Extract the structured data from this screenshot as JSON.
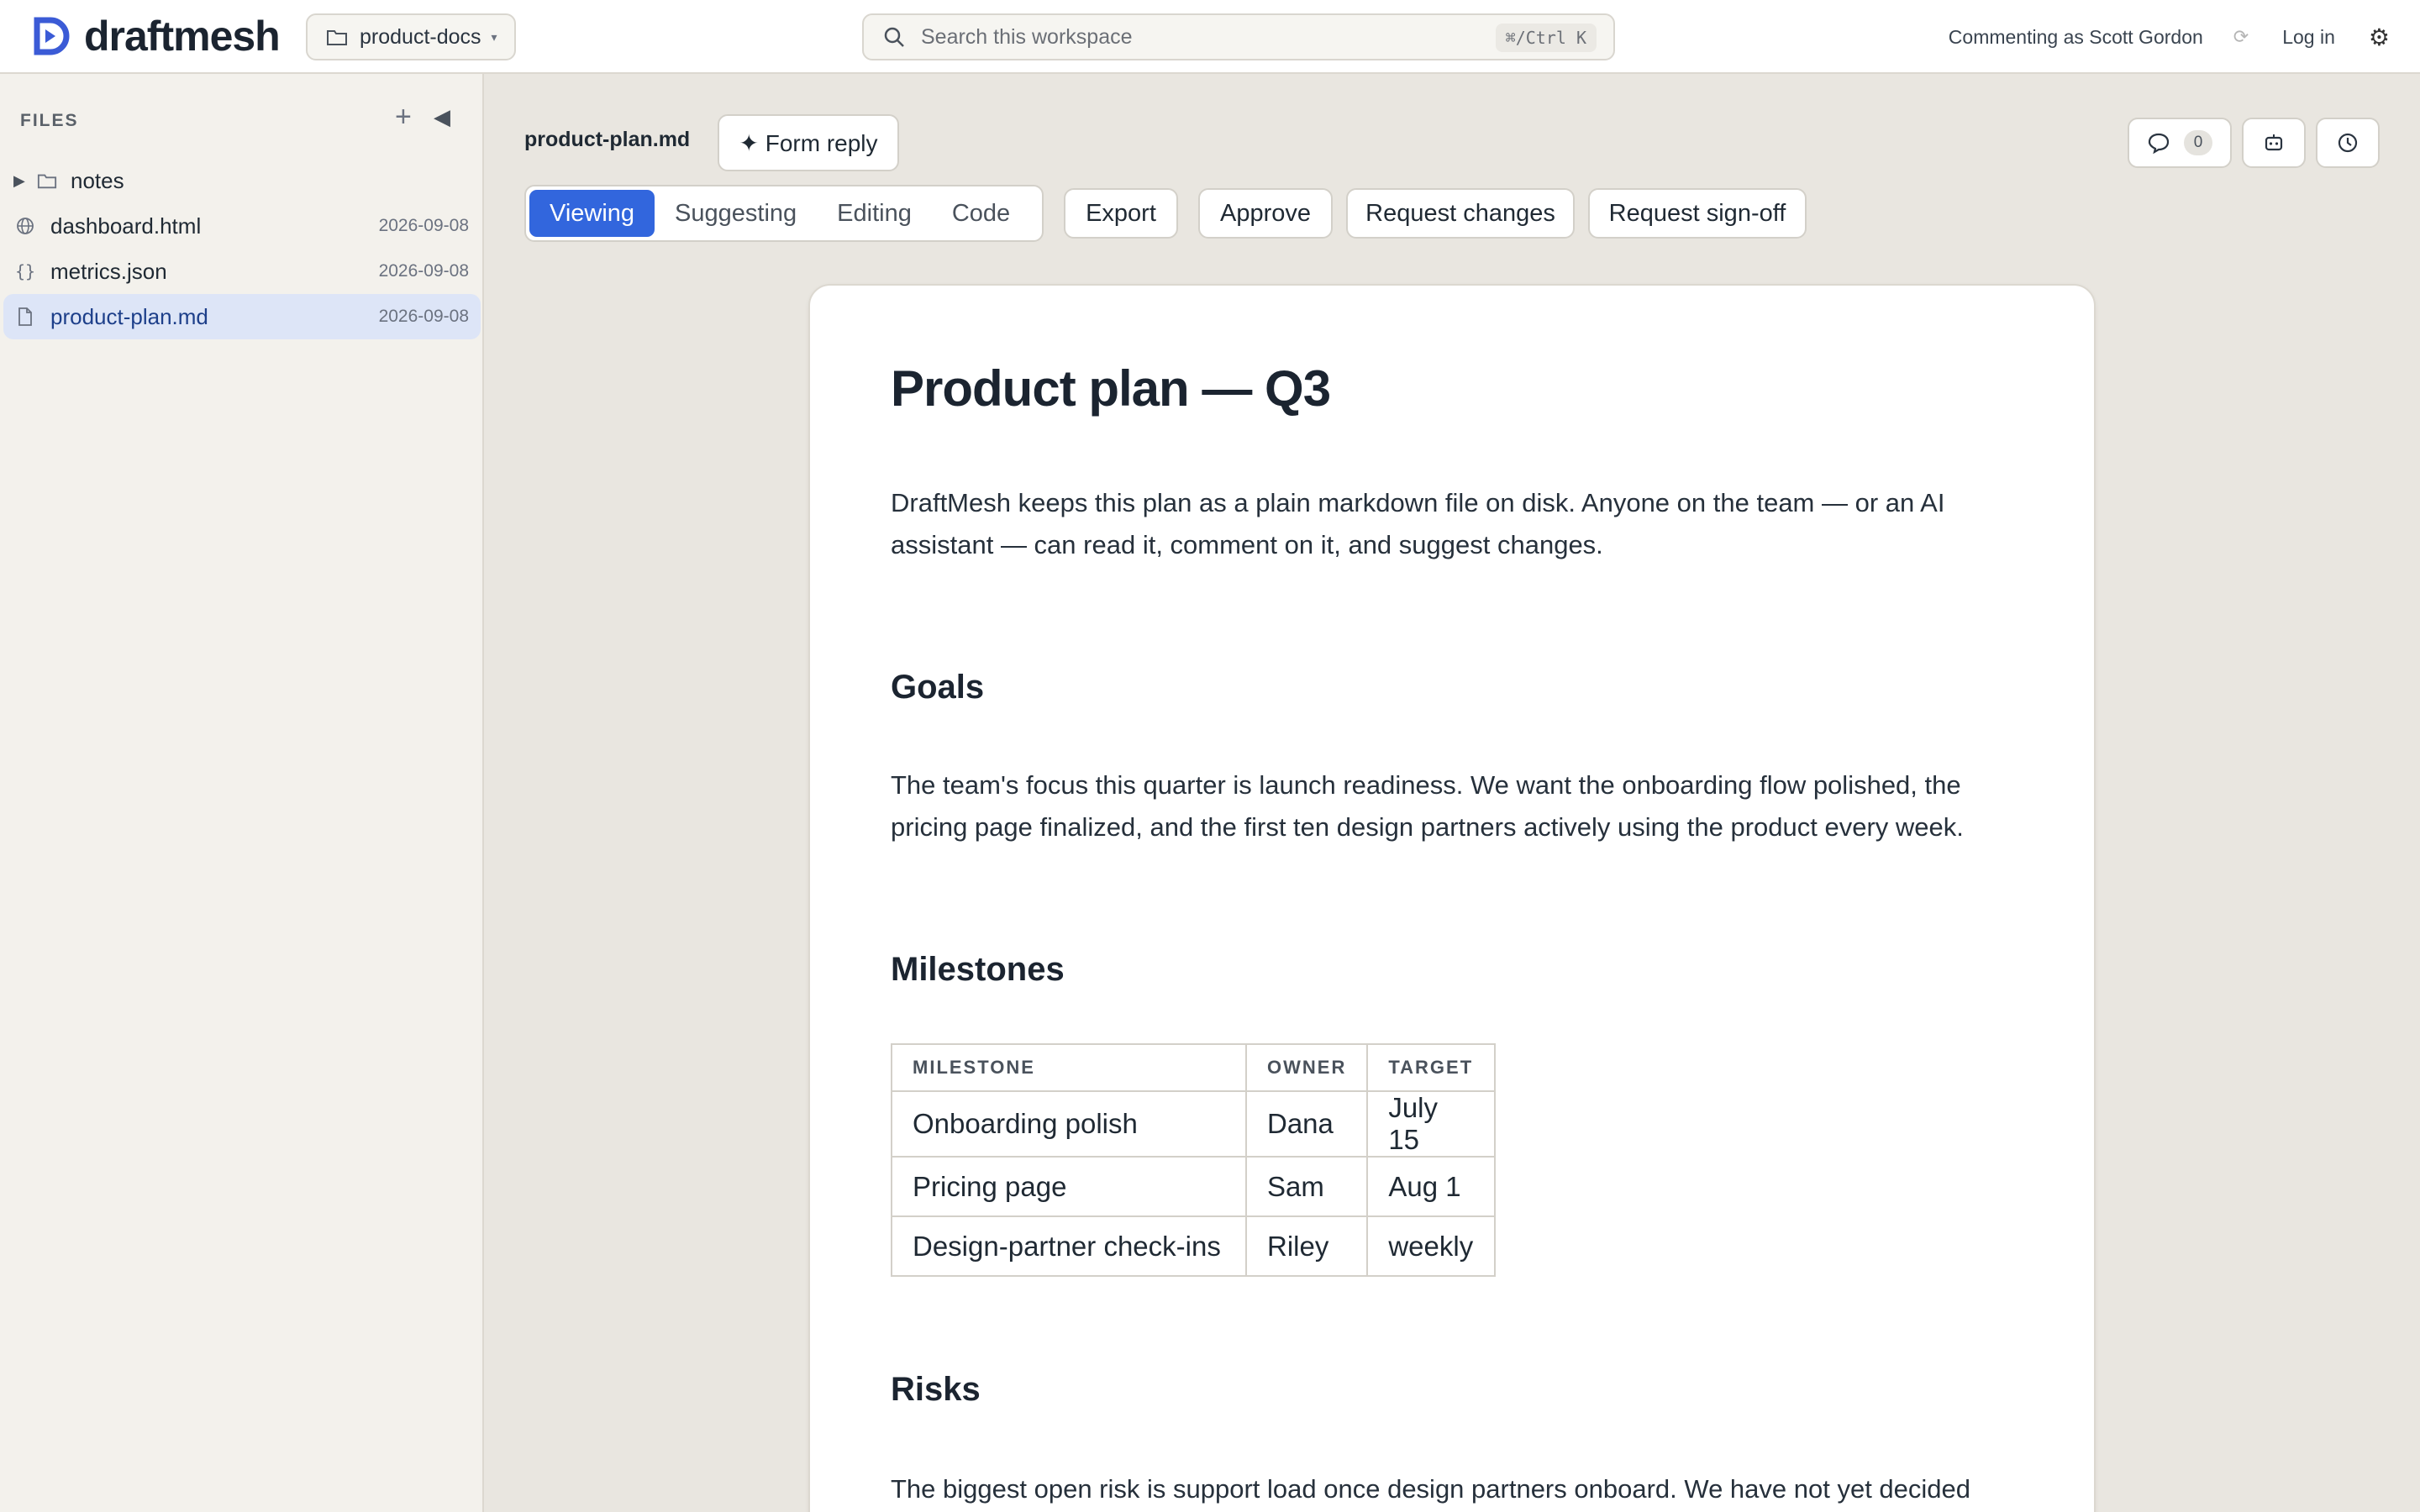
{
  "app": {
    "name": "draftmesh"
  },
  "workspace": {
    "label": "product-docs"
  },
  "search": {
    "placeholder": "Search this workspace",
    "shortcut": "⌘/Ctrl K"
  },
  "topbar": {
    "commenting_as": "Commenting as Scott Gordon",
    "login": "Log in"
  },
  "sidebar": {
    "header": "FILES",
    "items": [
      {
        "type": "folder",
        "name": "notes",
        "date": ""
      },
      {
        "type": "html",
        "name": "dashboard.html",
        "date": "2026-09-08"
      },
      {
        "type": "json",
        "name": "metrics.json",
        "date": "2026-09-08"
      },
      {
        "type": "md",
        "name": "product-plan.md",
        "date": "2026-09-08",
        "active": true
      }
    ]
  },
  "doc_header": {
    "file_name": "product-plan.md",
    "form_reply": "✦ Form reply",
    "comment_count": "0",
    "modes": [
      "Viewing",
      "Suggesting",
      "Editing",
      "Code"
    ],
    "active_mode": "Viewing",
    "actions": [
      "Export",
      "Approve",
      "Request changes",
      "Request sign-off"
    ]
  },
  "document": {
    "title": "Product plan — Q3",
    "intro": "DraftMesh keeps this plan as a plain markdown file on disk. Anyone on the team — or an AI assistant — can read it, comment on it, and suggest changes.",
    "goals_heading": "Goals",
    "goals_text": "The team's focus this quarter is launch readiness. We want the onboarding flow polished, the pricing page finalized, and the first ten design partners actively using the product every week.",
    "milestones_heading": "Milestones",
    "milestones_table": {
      "headers": [
        "MILESTONE",
        "OWNER",
        "TARGET"
      ],
      "rows": [
        [
          "Onboarding polish",
          "Dana",
          "July 15"
        ],
        [
          "Pricing page",
          "Sam",
          "Aug 1"
        ],
        [
          "Design-partner check-ins",
          "Riley",
          "weekly"
        ]
      ]
    },
    "risks_heading": "Risks",
    "risks_text": "The biggest open risk is support load once design partners onboard. We have not yet decided"
  },
  "colors": {
    "accent": "#3266dd",
    "active_row": "#dde5f7",
    "brand": "#3b5bd6"
  }
}
